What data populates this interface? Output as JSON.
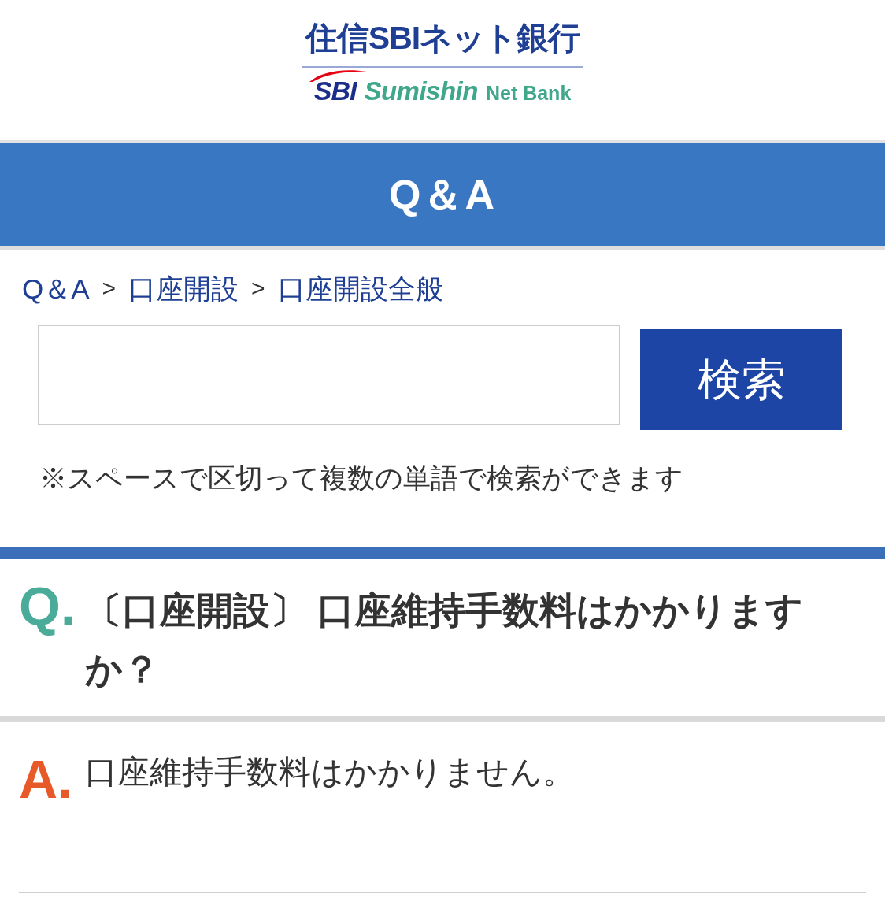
{
  "header": {
    "logo": {
      "title": "住信SBIネット銀行",
      "mark": "SBI",
      "name": "Sumishin",
      "suffix": "Net Bank"
    }
  },
  "banner": {
    "title": "Q＆A"
  },
  "breadcrumb": [
    {
      "kind": "link",
      "label": "Q＆A"
    },
    {
      "kind": "separator",
      "label": ">"
    },
    {
      "kind": "link",
      "label": "口座開設"
    },
    {
      "kind": "separator",
      "label": ">"
    },
    {
      "kind": "link",
      "label": "口座開設全般"
    }
  ],
  "search": {
    "button": "検索",
    "note": "※スペースで区切って複数の単語で検索ができます"
  },
  "question": {
    "marker": "Q.",
    "text": "〔口座開設〕 口座維持手数料はかかりますか？"
  },
  "answer": {
    "marker": "A.",
    "text": "口座維持手数料はかかりません。"
  }
}
